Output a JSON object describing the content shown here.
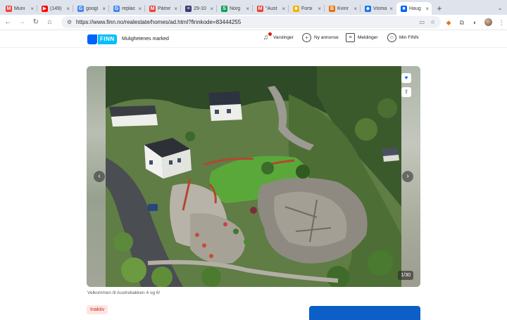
{
  "tabs": [
    {
      "title": "Muni",
      "icon": "gmail-icon",
      "color": "#ea4335",
      "glyph": "M"
    },
    {
      "title": "(149)",
      "icon": "youtube-icon",
      "color": "#ff0000",
      "glyph": "▶"
    },
    {
      "title": "googl",
      "icon": "google-icon",
      "color": "#4285f4",
      "glyph": "G"
    },
    {
      "title": "replac",
      "icon": "google-icon",
      "color": "#4285f4",
      "glyph": "G"
    },
    {
      "title": "Påmir",
      "icon": "gmail-icon",
      "color": "#ea4335",
      "glyph": "M"
    },
    {
      "title": "29-10",
      "icon": "us-flag-icon",
      "color": "#3c3b6e",
      "glyph": "≡"
    },
    {
      "title": "Norg",
      "icon": "norge-icon",
      "color": "#0f9d58",
      "glyph": "S"
    },
    {
      "title": "\"Aust",
      "icon": "gmail-icon",
      "color": "#ea4335",
      "glyph": "M"
    },
    {
      "title": "Forsi",
      "icon": "bookmark-icon",
      "color": "#f4b400",
      "glyph": "■"
    },
    {
      "title": "Kvinr",
      "icon": "b-icon",
      "color": "#e8710a",
      "glyph": "B"
    },
    {
      "title": "Visma",
      "icon": "visma-icon",
      "color": "#1a73e8",
      "glyph": "◆"
    },
    {
      "title": "Haug",
      "icon": "finn-icon",
      "color": "#0063fb",
      "glyph": "■",
      "active": true
    }
  ],
  "toolbar": {
    "url": "https://www.finn.no/realestate/homes/ad.html?finnkode=83444255"
  },
  "header": {
    "logo_text": "FINN",
    "tagline": "Mulighetenes marked",
    "nav": [
      {
        "label": "Varslinger",
        "icon": "bell-icon"
      },
      {
        "label": "Ny annonse",
        "icon": "plus-circle-icon"
      },
      {
        "label": "Meldinger",
        "icon": "chat-icon"
      },
      {
        "label": "Min FINN",
        "icon": "user-icon"
      }
    ]
  },
  "gallery": {
    "counter": "1/30",
    "caption": "Velkommen til Austrebakken 4 og 6!"
  },
  "status_badge": "Inaktiv",
  "colors": {
    "finn_blue": "#0063fb",
    "finn_cyan": "#06befb",
    "badge_bg": "#fde5e2",
    "badge_text": "#c0301f"
  }
}
